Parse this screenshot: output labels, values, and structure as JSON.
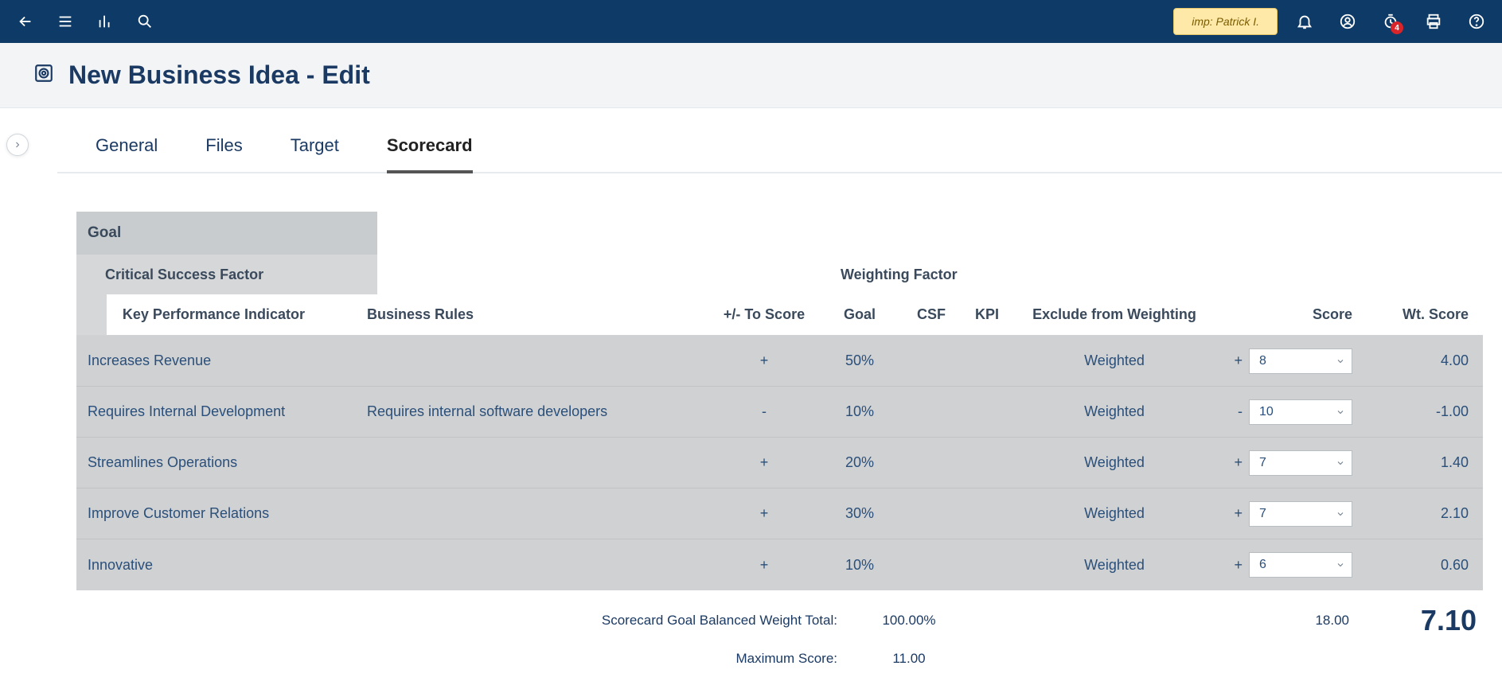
{
  "topbar": {
    "imp_label": "imp: Patrick I.",
    "notif_count": "4"
  },
  "header": {
    "title": "New Business Idea - Edit"
  },
  "tabs": [
    {
      "label": "General",
      "active": false
    },
    {
      "label": "Files",
      "active": false
    },
    {
      "label": "Target",
      "active": false
    },
    {
      "label": "Scorecard",
      "active": true
    }
  ],
  "columns": {
    "goal": "Goal",
    "csf": "Critical Success Factor",
    "kpi": "Key Performance Indicator",
    "rules": "Business Rules",
    "pm": "+/- To Score",
    "weighting_factor": "Weighting Factor",
    "goal_col": "Goal",
    "csf_col": "CSF",
    "kpi_col": "KPI",
    "exclude": "Exclude from Weighting",
    "score": "Score",
    "wt_score": "Wt. Score"
  },
  "rows": [
    {
      "name": "Increases Revenue",
      "rules": "",
      "pm": "+",
      "goal": "50%",
      "csf": "",
      "kpi": "",
      "exclude": "Weighted",
      "sign": "+",
      "score": "8",
      "wt": "4.00"
    },
    {
      "name": "Requires Internal Development",
      "rules": "Requires internal software developers",
      "pm": "-",
      "goal": "10%",
      "csf": "",
      "kpi": "",
      "exclude": "Weighted",
      "sign": "-",
      "score": "10",
      "wt": "-1.00"
    },
    {
      "name": "Streamlines Operations",
      "rules": "",
      "pm": "+",
      "goal": "20%",
      "csf": "",
      "kpi": "",
      "exclude": "Weighted",
      "sign": "+",
      "score": "7",
      "wt": "1.40"
    },
    {
      "name": "Improve Customer Relations",
      "rules": "",
      "pm": "+",
      "goal": "30%",
      "csf": "",
      "kpi": "",
      "exclude": "Weighted",
      "sign": "+",
      "score": "7",
      "wt": "2.10"
    },
    {
      "name": "Innovative",
      "rules": "",
      "pm": "+",
      "goal": "10%",
      "csf": "",
      "kpi": "",
      "exclude": "Weighted",
      "sign": "+",
      "score": "6",
      "wt": "0.60"
    }
  ],
  "totals": {
    "balanced_label": "Scorecard Goal Balanced Weight Total:",
    "balanced_value": "100.00%",
    "balanced_score": "18.00",
    "grand_total": "7.10",
    "max_label": "Maximum Score:",
    "max_value": "11.00"
  }
}
